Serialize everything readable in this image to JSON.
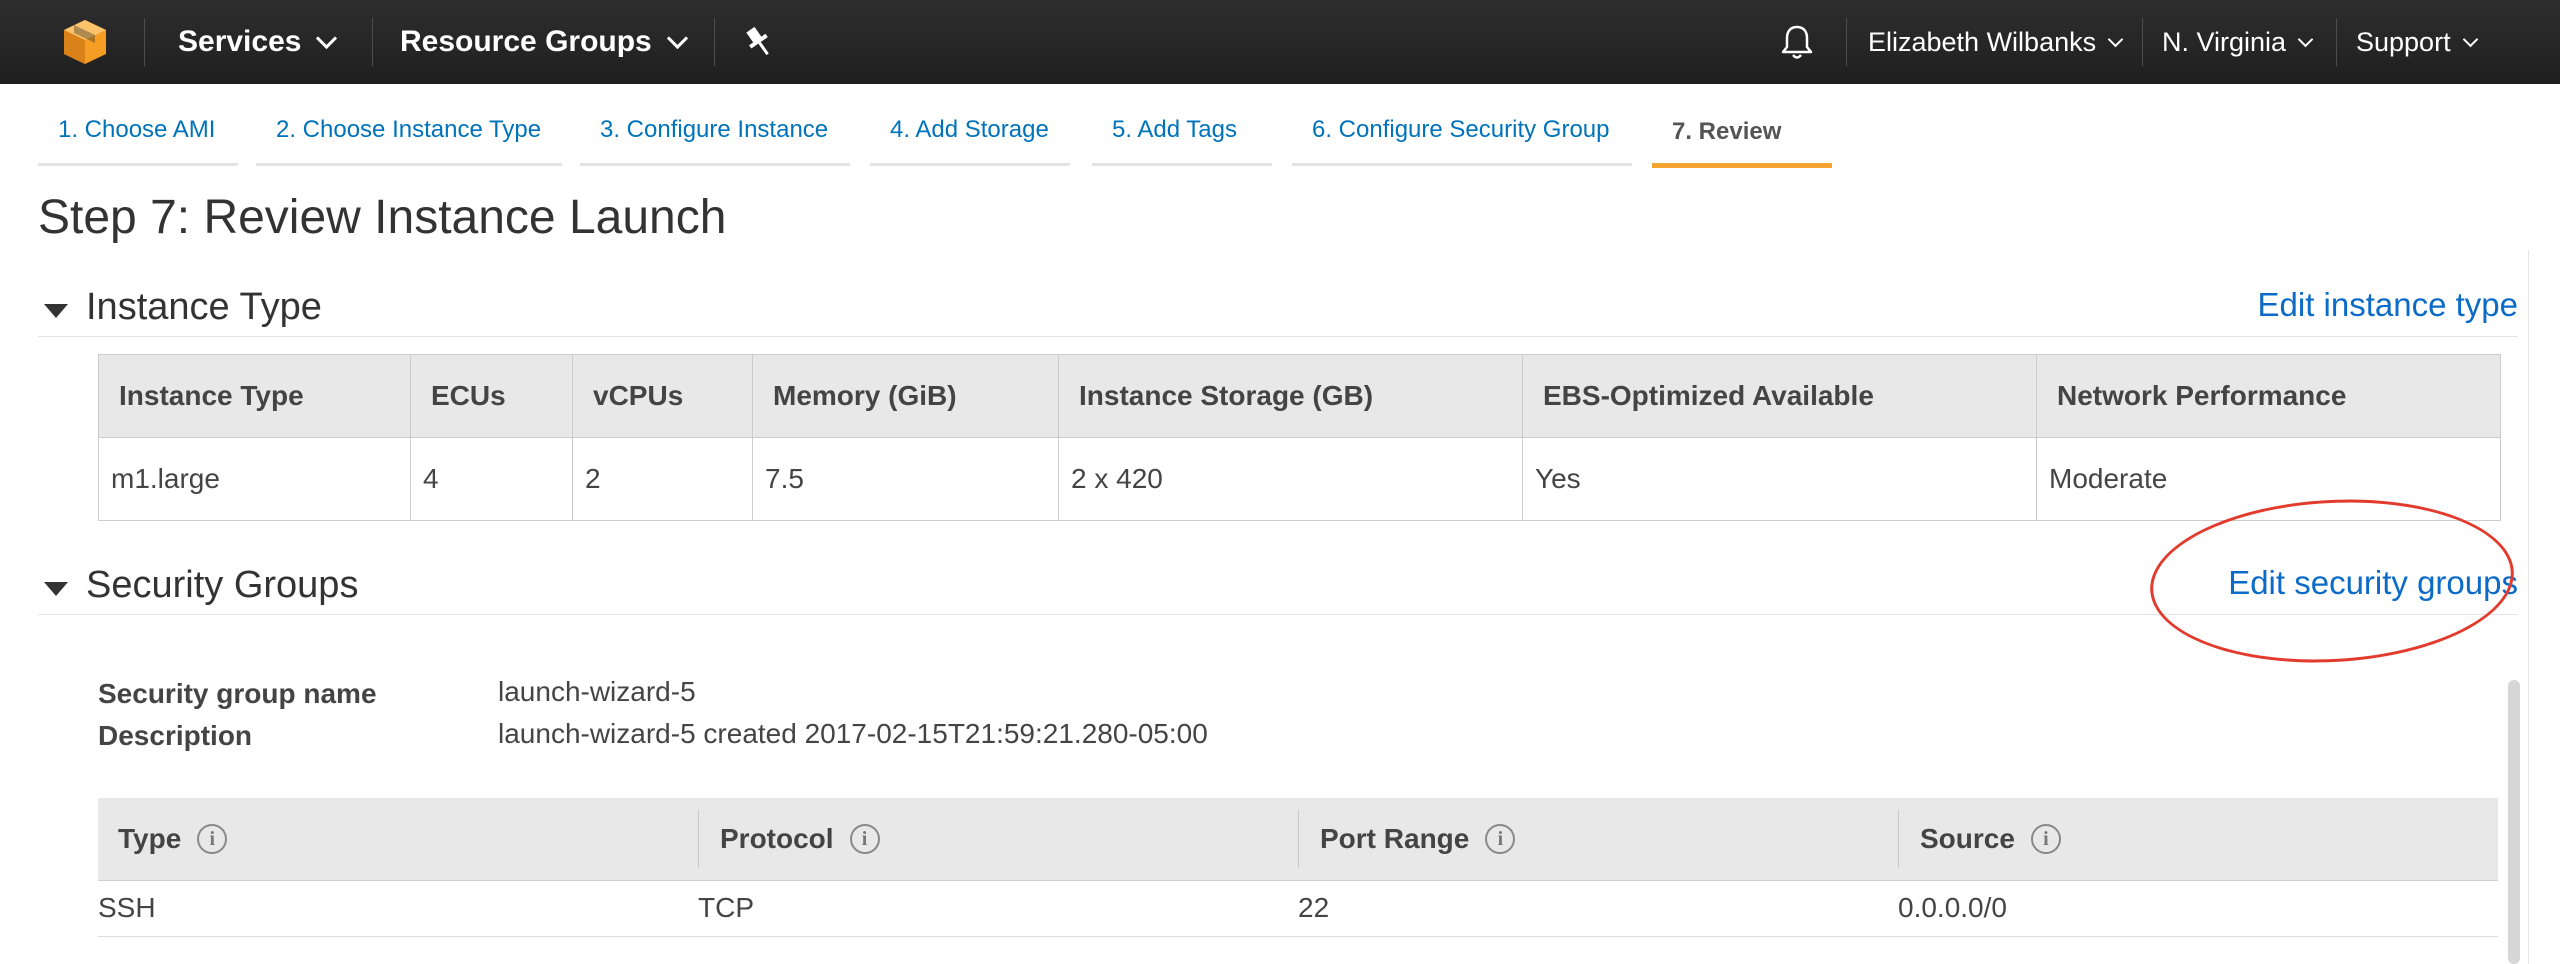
{
  "nav": {
    "services": "Services",
    "resource_groups": "Resource Groups",
    "user": "Elizabeth Wilbanks",
    "region": "N. Virginia",
    "support": "Support"
  },
  "wizard_tabs": [
    {
      "label": "1. Choose AMI"
    },
    {
      "label": "2. Choose Instance Type"
    },
    {
      "label": "3. Configure Instance"
    },
    {
      "label": "4. Add Storage"
    },
    {
      "label": "5. Add Tags"
    },
    {
      "label": "6. Configure Security Group"
    },
    {
      "label": "7. Review"
    }
  ],
  "page_title": "Step 7: Review Instance Launch",
  "instance_section": {
    "title": "Instance Type",
    "edit_link": "Edit instance type",
    "headers": [
      "Instance Type",
      "ECUs",
      "vCPUs",
      "Memory (GiB)",
      "Instance Storage (GB)",
      "EBS-Optimized Available",
      "Network Performance"
    ],
    "row": [
      "m1.large",
      "4",
      "2",
      "7.5",
      "2 x 420",
      "Yes",
      "Moderate"
    ]
  },
  "security_section": {
    "title": "Security Groups",
    "edit_link": "Edit security groups",
    "name_label": "Security group name",
    "name_value": "launch-wizard-5",
    "desc_label": "Description",
    "desc_value": "launch-wizard-5 created 2017-02-15T21:59:21.280-05:00",
    "rule_headers": [
      "Type",
      "Protocol",
      "Port Range",
      "Source"
    ],
    "rules": [
      {
        "type": "SSH",
        "protocol": "TCP",
        "port_range": "22",
        "source": "0.0.0.0/0"
      }
    ]
  },
  "colors": {
    "nav_bg": "#232323",
    "link": "#0073bb",
    "active_tab_underline": "#f4a431",
    "annotation": "#e23b2e",
    "logo": "#f59e23"
  },
  "icons": {
    "logo": "aws-cube-logo",
    "pin": "pushpin-icon",
    "bell": "bell-icon",
    "info": "info-icon"
  },
  "info_glyph": "i"
}
